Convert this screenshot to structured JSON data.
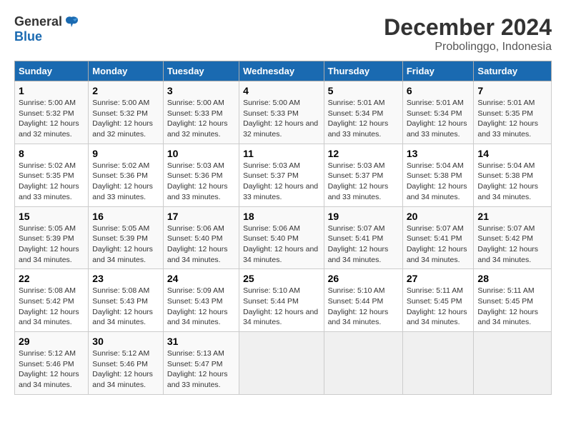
{
  "logo": {
    "general": "General",
    "blue": "Blue"
  },
  "title": "December 2024",
  "subtitle": "Probolinggo, Indonesia",
  "days_header": [
    "Sunday",
    "Monday",
    "Tuesday",
    "Wednesday",
    "Thursday",
    "Friday",
    "Saturday"
  ],
  "weeks": [
    [
      {
        "day": "1",
        "sunrise": "5:00 AM",
        "sunset": "5:32 PM",
        "daylight": "12 hours and 32 minutes."
      },
      {
        "day": "2",
        "sunrise": "5:00 AM",
        "sunset": "5:32 PM",
        "daylight": "12 hours and 32 minutes."
      },
      {
        "day": "3",
        "sunrise": "5:00 AM",
        "sunset": "5:33 PM",
        "daylight": "12 hours and 32 minutes."
      },
      {
        "day": "4",
        "sunrise": "5:00 AM",
        "sunset": "5:33 PM",
        "daylight": "12 hours and 32 minutes."
      },
      {
        "day": "5",
        "sunrise": "5:01 AM",
        "sunset": "5:34 PM",
        "daylight": "12 hours and 33 minutes."
      },
      {
        "day": "6",
        "sunrise": "5:01 AM",
        "sunset": "5:34 PM",
        "daylight": "12 hours and 33 minutes."
      },
      {
        "day": "7",
        "sunrise": "5:01 AM",
        "sunset": "5:35 PM",
        "daylight": "12 hours and 33 minutes."
      }
    ],
    [
      {
        "day": "8",
        "sunrise": "5:02 AM",
        "sunset": "5:35 PM",
        "daylight": "12 hours and 33 minutes."
      },
      {
        "day": "9",
        "sunrise": "5:02 AM",
        "sunset": "5:36 PM",
        "daylight": "12 hours and 33 minutes."
      },
      {
        "day": "10",
        "sunrise": "5:03 AM",
        "sunset": "5:36 PM",
        "daylight": "12 hours and 33 minutes."
      },
      {
        "day": "11",
        "sunrise": "5:03 AM",
        "sunset": "5:37 PM",
        "daylight": "12 hours and 33 minutes."
      },
      {
        "day": "12",
        "sunrise": "5:03 AM",
        "sunset": "5:37 PM",
        "daylight": "12 hours and 33 minutes."
      },
      {
        "day": "13",
        "sunrise": "5:04 AM",
        "sunset": "5:38 PM",
        "daylight": "12 hours and 34 minutes."
      },
      {
        "day": "14",
        "sunrise": "5:04 AM",
        "sunset": "5:38 PM",
        "daylight": "12 hours and 34 minutes."
      }
    ],
    [
      {
        "day": "15",
        "sunrise": "5:05 AM",
        "sunset": "5:39 PM",
        "daylight": "12 hours and 34 minutes."
      },
      {
        "day": "16",
        "sunrise": "5:05 AM",
        "sunset": "5:39 PM",
        "daylight": "12 hours and 34 minutes."
      },
      {
        "day": "17",
        "sunrise": "5:06 AM",
        "sunset": "5:40 PM",
        "daylight": "12 hours and 34 minutes."
      },
      {
        "day": "18",
        "sunrise": "5:06 AM",
        "sunset": "5:40 PM",
        "daylight": "12 hours and 34 minutes."
      },
      {
        "day": "19",
        "sunrise": "5:07 AM",
        "sunset": "5:41 PM",
        "daylight": "12 hours and 34 minutes."
      },
      {
        "day": "20",
        "sunrise": "5:07 AM",
        "sunset": "5:41 PM",
        "daylight": "12 hours and 34 minutes."
      },
      {
        "day": "21",
        "sunrise": "5:07 AM",
        "sunset": "5:42 PM",
        "daylight": "12 hours and 34 minutes."
      }
    ],
    [
      {
        "day": "22",
        "sunrise": "5:08 AM",
        "sunset": "5:42 PM",
        "daylight": "12 hours and 34 minutes."
      },
      {
        "day": "23",
        "sunrise": "5:08 AM",
        "sunset": "5:43 PM",
        "daylight": "12 hours and 34 minutes."
      },
      {
        "day": "24",
        "sunrise": "5:09 AM",
        "sunset": "5:43 PM",
        "daylight": "12 hours and 34 minutes."
      },
      {
        "day": "25",
        "sunrise": "5:10 AM",
        "sunset": "5:44 PM",
        "daylight": "12 hours and 34 minutes."
      },
      {
        "day": "26",
        "sunrise": "5:10 AM",
        "sunset": "5:44 PM",
        "daylight": "12 hours and 34 minutes."
      },
      {
        "day": "27",
        "sunrise": "5:11 AM",
        "sunset": "5:45 PM",
        "daylight": "12 hours and 34 minutes."
      },
      {
        "day": "28",
        "sunrise": "5:11 AM",
        "sunset": "5:45 PM",
        "daylight": "12 hours and 34 minutes."
      }
    ],
    [
      {
        "day": "29",
        "sunrise": "5:12 AM",
        "sunset": "5:46 PM",
        "daylight": "12 hours and 34 minutes."
      },
      {
        "day": "30",
        "sunrise": "5:12 AM",
        "sunset": "5:46 PM",
        "daylight": "12 hours and 34 minutes."
      },
      {
        "day": "31",
        "sunrise": "5:13 AM",
        "sunset": "5:47 PM",
        "daylight": "12 hours and 33 minutes."
      },
      null,
      null,
      null,
      null
    ]
  ]
}
